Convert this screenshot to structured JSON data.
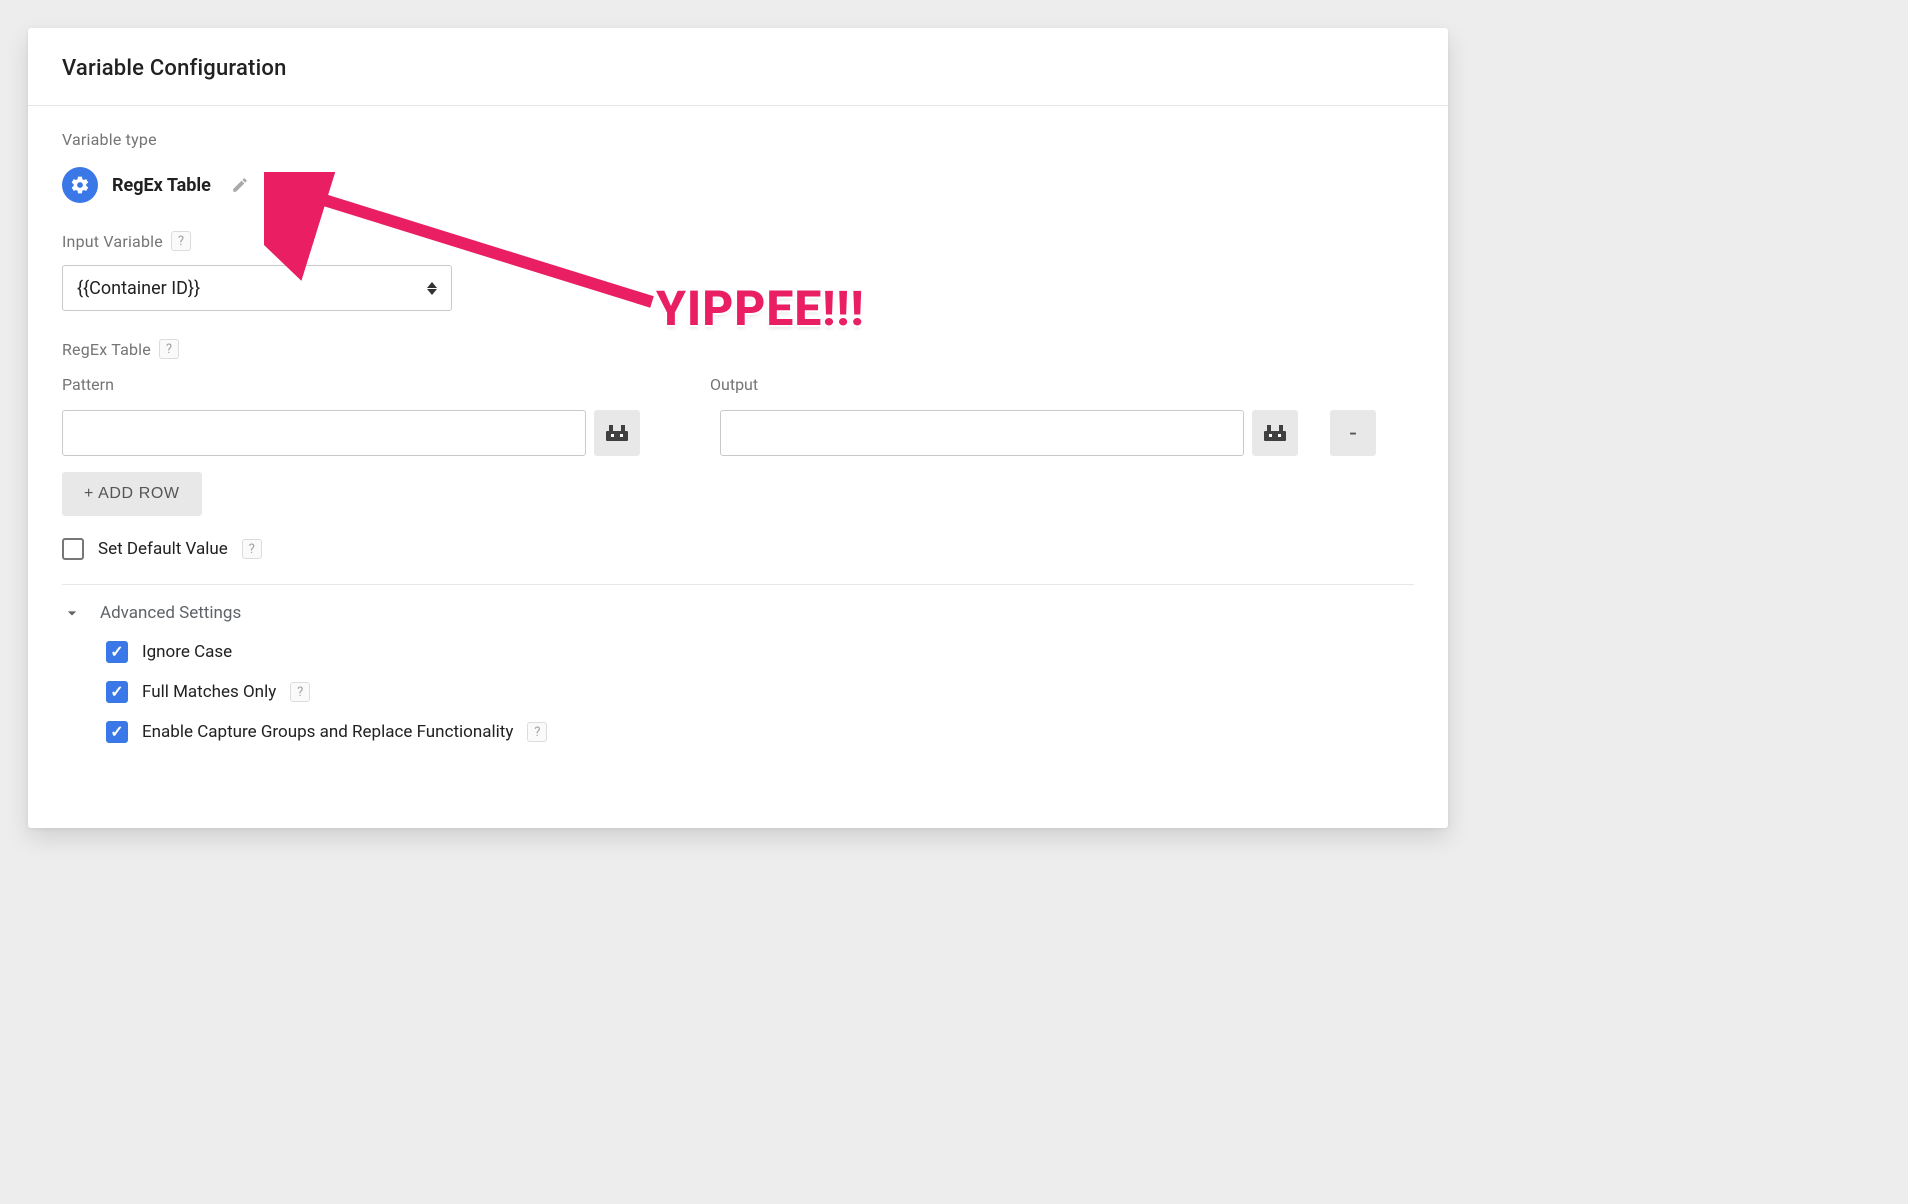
{
  "header": {
    "title": "Variable Configuration"
  },
  "variableType": {
    "label": "Variable type",
    "name": "RegEx Table"
  },
  "inputVariable": {
    "label": "Input Variable",
    "value": "{{Container ID}}"
  },
  "regexTable": {
    "label": "RegEx Table",
    "patternLabel": "Pattern",
    "outputLabel": "Output",
    "rows": [
      {
        "pattern": "",
        "output": ""
      }
    ],
    "addRowLabel": "+ ADD ROW",
    "removeLabel": "-"
  },
  "setDefault": {
    "label": "Set Default Value",
    "checked": false
  },
  "advanced": {
    "label": "Advanced Settings",
    "expanded": true,
    "options": {
      "ignoreCase": {
        "label": "Ignore Case",
        "checked": true,
        "help": false
      },
      "fullMatches": {
        "label": "Full Matches Only",
        "checked": true,
        "help": true
      },
      "captureGroups": {
        "label": "Enable Capture Groups and Replace Functionality",
        "checked": true,
        "help": true
      }
    }
  },
  "annotation": {
    "text": "YIPPEE!!!"
  },
  "helpGlyph": "?"
}
